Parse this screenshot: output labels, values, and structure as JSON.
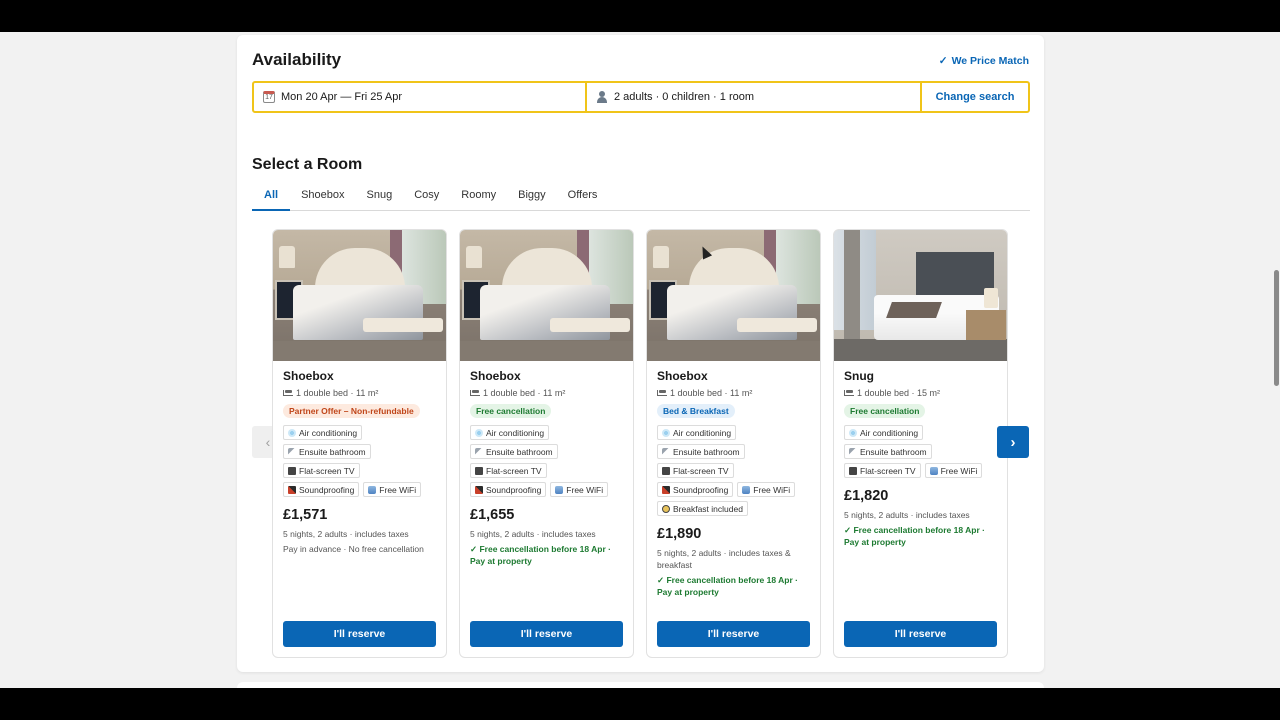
{
  "availability": {
    "title": "Availability",
    "price_match": "We Price Match",
    "dates": "Mon 20 Apr — Fri 25 Apr",
    "guests": "2 adults · 0 children · 1 room",
    "change_search": "Change search"
  },
  "select_room": {
    "title": "Select a Room",
    "tabs": [
      "All",
      "Shoebox",
      "Snug",
      "Cosy",
      "Roomy",
      "Biggy",
      "Offers"
    ],
    "active_tab": "All"
  },
  "rooms": [
    {
      "name": "Shoebox",
      "meta": "1 double bed · 11 m²",
      "badge": "Partner Offer – Non-refundable",
      "badge_color": "#c0461a",
      "amenities": [
        "Air conditioning",
        "Ensuite bathroom",
        "Flat-screen TV",
        "Soundproofing",
        "Free WiFi"
      ],
      "price": "£1,571",
      "price_sub": "5 nights, 2 adults · includes taxes",
      "policy": "Pay in advance · No free cancellation",
      "reserve": "I'll reserve"
    },
    {
      "name": "Shoebox",
      "meta": "1 double bed · 11 m²",
      "badge": "Free cancellation",
      "badge_color": "#1d7a31",
      "amenities": [
        "Air conditioning",
        "Ensuite bathroom",
        "Flat-screen TV",
        "Soundproofing",
        "Free WiFi"
      ],
      "price": "£1,655",
      "price_sub": "5 nights, 2 adults · includes taxes",
      "policy": "✓ Free cancellation before 18 Apr · Pay at property",
      "reserve": "I'll reserve"
    },
    {
      "name": "Shoebox",
      "meta": "1 double bed · 11 m²",
      "badge": "Bed & Breakfast",
      "badge_color": "#0a66b5",
      "amenities": [
        "Air conditioning",
        "Ensuite bathroom",
        "Flat-screen TV",
        "Soundproofing",
        "Free WiFi",
        "Breakfast included"
      ],
      "price": "£1,890",
      "price_sub": "5 nights, 2 adults · includes taxes & breakfast",
      "policy": "✓ Free cancellation before 18 Apr · Pay at property",
      "reserve": "I'll reserve"
    },
    {
      "name": "Snug",
      "meta": "1 double bed · 15 m²",
      "badge": "Free cancellation",
      "badge_color": "#1d7a31",
      "amenities": [
        "Air conditioning",
        "Ensuite bathroom",
        "Flat-screen TV",
        "Free WiFi"
      ],
      "price": "£1,820",
      "price_sub": "5 nights, 2 adults · includes taxes",
      "policy": "✓ Free cancellation before 18 Apr · Pay at property",
      "reserve": "I'll reserve"
    }
  ],
  "icons": {
    "calendar_day": "17",
    "check": "✓",
    "next": "›",
    "prev": "‹"
  }
}
